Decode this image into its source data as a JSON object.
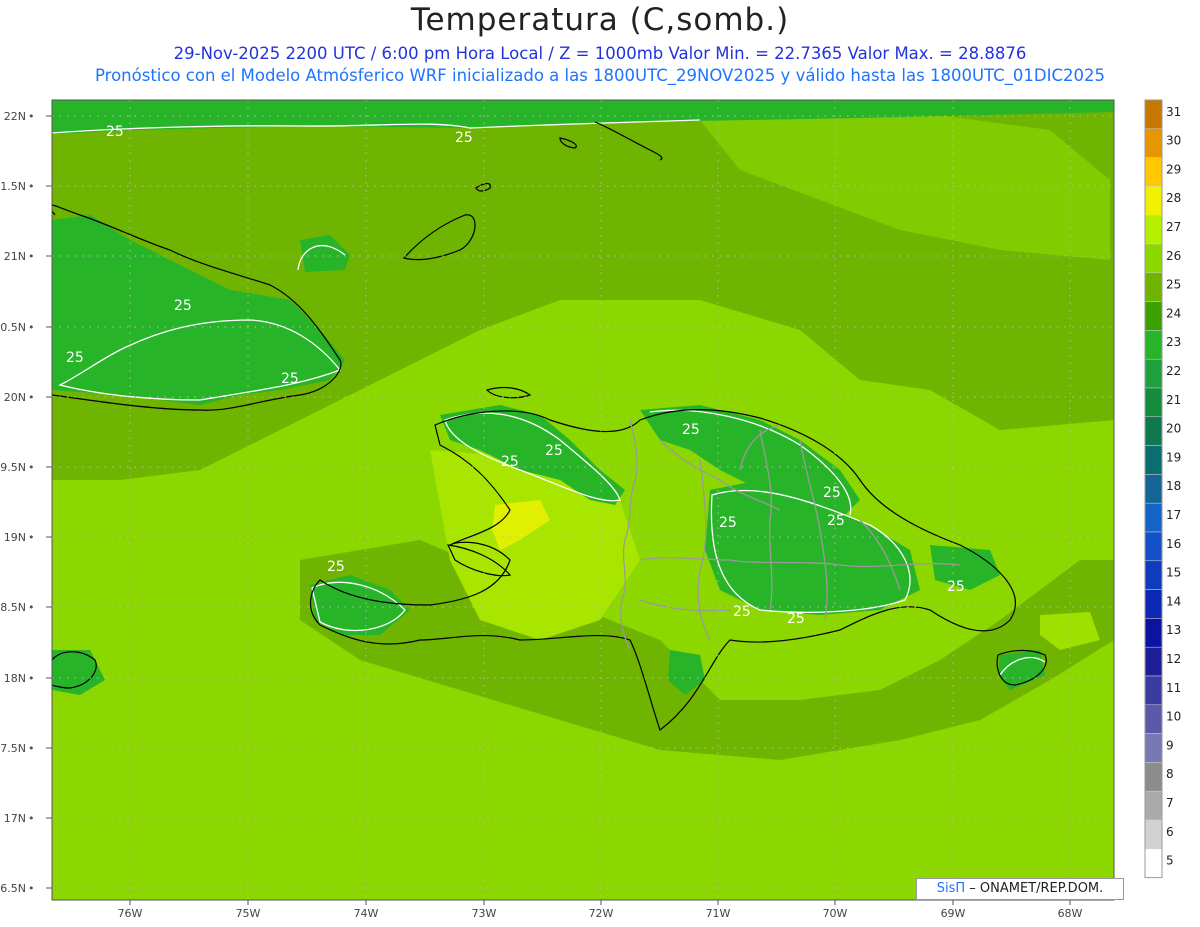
{
  "header": {
    "title": "Temperatura (C,somb.)",
    "line1": "29-Nov-2025  2200 UTC / 6:00 pm Hora Local / Z = 1000mb   Valor Min. = 22.7365  Valor Max. = 28.8876",
    "line2": "Pronóstico con el Modelo Atmósferico WRF inicializado a las 1800UTC_29NOV2025 y válido hasta las  1800UTC_01DIC2025"
  },
  "lat_labels": [
    "22N",
    "1.5N",
    "21N",
    "0.5N",
    "20N",
    "9.5N",
    "19N",
    "8.5N",
    "18N",
    "7.5N",
    "17N",
    "6.5N"
  ],
  "lon_labels": [
    "76W",
    "75W",
    "74W",
    "73W",
    "72W",
    "71W",
    "70W",
    "69W",
    "68W"
  ],
  "contour_labels": [
    "25",
    "25",
    "25",
    "25",
    "25",
    "25",
    "25",
    "25",
    "25",
    "25",
    "25",
    "25",
    "25",
    "25",
    "25"
  ],
  "colorbar": {
    "labels": [
      "31",
      "30",
      "29",
      "28",
      "27",
      "26",
      "25",
      "24",
      "23",
      "22",
      "21",
      "20",
      "19",
      "18",
      "17",
      "16",
      "15",
      "14",
      "13",
      "12",
      "11",
      "10",
      "9",
      "8",
      "7",
      "6",
      "5"
    ],
    "colors": [
      "#c87800",
      "#e69600",
      "#ffc800",
      "#f0f000",
      "#b4f000",
      "#8cd700",
      "#6eb400",
      "#3ca000",
      "#28b428",
      "#1ea03c",
      "#148c3c",
      "#0f7850",
      "#0a6e6e",
      "#146496",
      "#1464c8",
      "#1450c8",
      "#0f3cbe",
      "#0a28b4",
      "#0a14a0",
      "#1e1e96",
      "#3c3ca0",
      "#5a5aaa",
      "#7878b4",
      "#8c8c8c",
      "#aaaaaa",
      "#d2d2d2",
      "#ffffff"
    ]
  },
  "credit": {
    "brand": "SisΠ",
    "text": " – ONAMET/REP.DOM."
  }
}
